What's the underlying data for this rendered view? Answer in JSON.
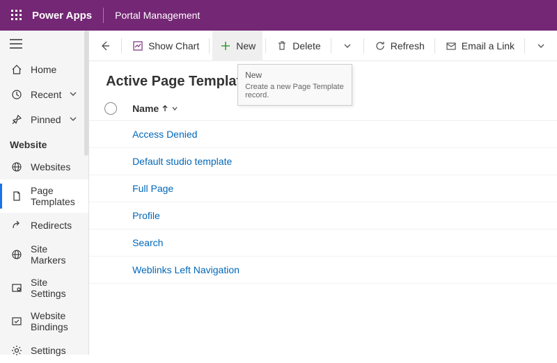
{
  "header": {
    "brand": "Power Apps",
    "app_title": "Portal Management"
  },
  "sidebar": {
    "home": "Home",
    "recent": "Recent",
    "pinned": "Pinned",
    "section": "Website",
    "items": [
      "Websites",
      "Page Templates",
      "Redirects",
      "Site Markers",
      "Site Settings",
      "Website Bindings",
      "Settings"
    ]
  },
  "commands": {
    "show_chart": "Show Chart",
    "new": "New",
    "delete": "Delete",
    "refresh": "Refresh",
    "email_link": "Email a Link"
  },
  "tooltip": {
    "title": "New",
    "body": "Create a new Page Template record."
  },
  "page": {
    "title": "Active Page Templates"
  },
  "grid": {
    "col_name": "Name",
    "rows": [
      "Access Denied",
      "Default studio template",
      "Full Page",
      "Profile",
      "Search",
      "Weblinks Left Navigation"
    ]
  }
}
